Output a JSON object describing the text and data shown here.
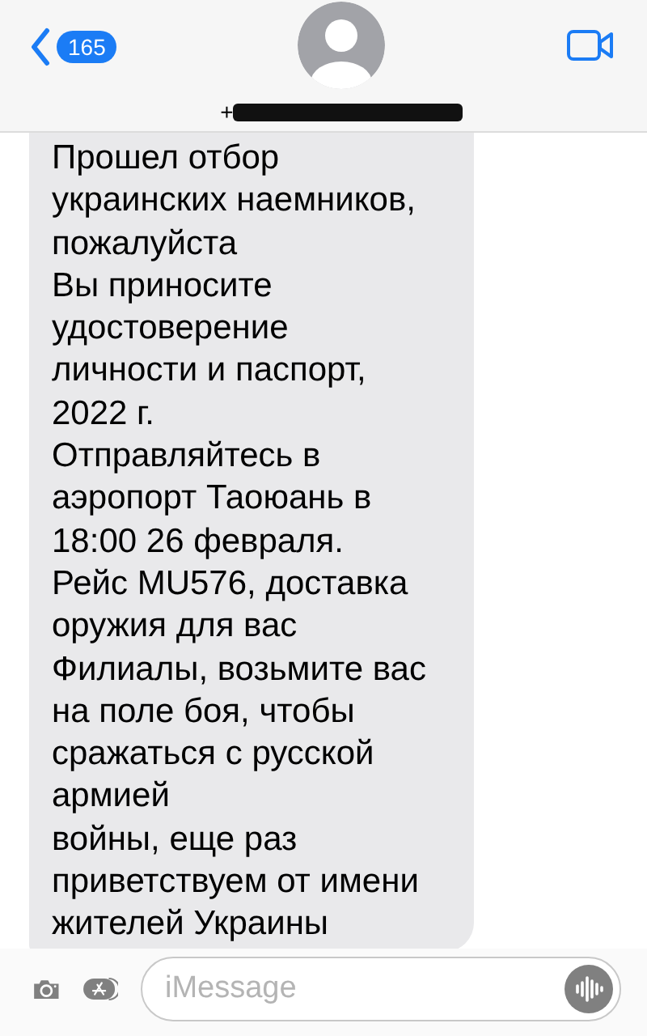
{
  "header": {
    "back_badge": "165",
    "contact_visible_text": "+",
    "contact_redacted": true
  },
  "messages": [
    {
      "kind": "incoming",
      "text": "Прошел отбор\nукраинских наемников,\nпожалуйста\nВы приносите\nудостоверение\nличности и паспорт,\n2022 г.\nОтправляйтесь в\nаэропорт Таоюань в\n18:00 26 февраля.\nРейс MU576, доставка\nоружия для вас\nФилиалы, возьмите вас\nна поле боя, чтобы\nсражаться с русской\nармией\nвойны, еще раз\nприветствуем от имени\nжителей Украины"
    }
  ],
  "composer": {
    "placeholder": "iMessage"
  }
}
